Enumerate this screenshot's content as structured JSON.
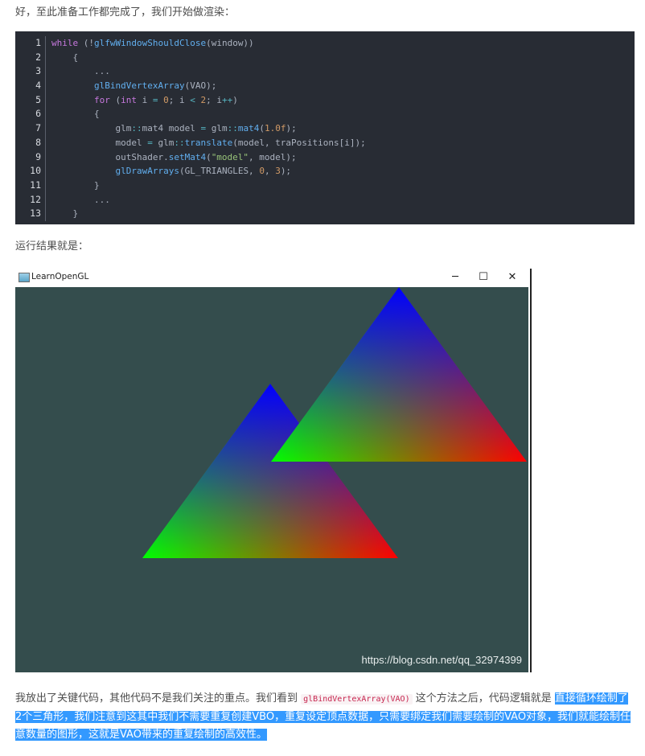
{
  "intro_text": "好，至此准备工作都完成了，我们开始做渲染：",
  "code_lines": [
    {
      "n": "1",
      "parts": [
        [
          "kw",
          "while"
        ],
        [
          "",
          " (!"
        ],
        [
          "fn",
          "glfwWindowShouldClose"
        ],
        [
          "",
          "(window))"
        ]
      ]
    },
    {
      "n": "2",
      "parts": [
        [
          "",
          "    {"
        ]
      ]
    },
    {
      "n": "3",
      "parts": [
        [
          "",
          "        ..."
        ]
      ]
    },
    {
      "n": "4",
      "parts": [
        [
          "",
          "        "
        ],
        [
          "fn",
          "glBindVertexArray"
        ],
        [
          "",
          "(VAO);"
        ]
      ]
    },
    {
      "n": "5",
      "parts": [
        [
          "",
          "        "
        ],
        [
          "kw",
          "for"
        ],
        [
          "",
          " ("
        ],
        [
          "kw",
          "int"
        ],
        [
          "",
          " i "
        ],
        [
          "op",
          "="
        ],
        [
          "",
          ""
        ],
        [
          "num",
          " 0"
        ],
        [
          "",
          "; i "
        ],
        [
          "op",
          "<"
        ],
        [
          "num",
          " 2"
        ],
        [
          "",
          "; i"
        ],
        [
          "op",
          "++"
        ],
        [
          "",
          ")"
        ]
      ]
    },
    {
      "n": "6",
      "parts": [
        [
          "",
          "        {"
        ]
      ]
    },
    {
      "n": "7",
      "parts": [
        [
          "",
          "            glm"
        ],
        [
          "op",
          "::"
        ],
        [
          "",
          "mat4 model "
        ],
        [
          "op",
          "="
        ],
        [
          "",
          " glm"
        ],
        [
          "op",
          "::"
        ],
        [
          "fn",
          "mat4"
        ],
        [
          "",
          "("
        ],
        [
          "num",
          "1.0f"
        ],
        [
          "",
          ");"
        ]
      ]
    },
    {
      "n": "8",
      "parts": [
        [
          "",
          "            model "
        ],
        [
          "op",
          "="
        ],
        [
          "",
          " glm"
        ],
        [
          "op",
          "::"
        ],
        [
          "fn",
          "translate"
        ],
        [
          "",
          "(model, traPositions[i]);"
        ]
      ]
    },
    {
      "n": "9",
      "parts": [
        [
          "",
          "            outShader."
        ],
        [
          "fn",
          "setMat4"
        ],
        [
          "",
          "("
        ],
        [
          "str",
          "\"model\""
        ],
        [
          "",
          ", model);"
        ]
      ]
    },
    {
      "n": "10",
      "parts": [
        [
          "",
          "            "
        ],
        [
          "fn",
          "glDrawArrays"
        ],
        [
          "",
          "(GL_TRIANGLES, "
        ],
        [
          "num",
          "0"
        ],
        [
          "",
          ", "
        ],
        [
          "num",
          "3"
        ],
        [
          "",
          ");"
        ]
      ]
    },
    {
      "n": "11",
      "parts": [
        [
          "",
          "        }"
        ]
      ]
    },
    {
      "n": "12",
      "parts": [
        [
          "",
          "        ..."
        ]
      ]
    },
    {
      "n": "13",
      "parts": [
        [
          "",
          "    }"
        ]
      ]
    }
  ],
  "result_text": "运行结果就是：",
  "window": {
    "title": "LearnOpenGL",
    "minimize": "─",
    "maximize": "☐",
    "close": "✕",
    "background": "#344d4d",
    "triangle_colors": [
      "#00ff00",
      "#0000ff",
      "#ff0000"
    ]
  },
  "watermark": "https://blog.csdn.net/qq_32974399",
  "summary": {
    "before_code": "我放出了关键代码，其他代码不是我们关注的重点。我们看到 ",
    "inline_code": "glBindVertexArray(VAO)",
    "after_code": " 这个方法之后，代码逻辑就是",
    "highlighted": "直接循环绘制了2个三角形，我们注意到这其中我们不需要重复创建VBO，重复设定顶点数据，只需要绑定我们需要绘制的VAO对象，我们就能绘制任意数量的图形，这就是VAO带来的重复绘制的高效性。"
  }
}
